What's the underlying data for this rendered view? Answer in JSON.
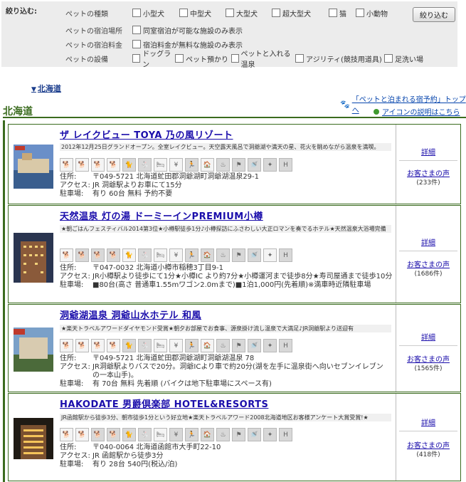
{
  "filter": {
    "title": "絞り込む:",
    "button": "絞り込む",
    "rows": [
      {
        "label": "ペットの種類",
        "options": [
          "小型犬",
          "中型犬",
          "大型犬",
          "超大型犬",
          "猫",
          "小動物"
        ]
      },
      {
        "label": "ペットの宿泊場所",
        "options": [
          "同室宿泊が可能な施設のみ表示"
        ]
      },
      {
        "label": "ペットの宿泊料金",
        "options": [
          "宿泊料金が無料な施設のみ表示"
        ]
      },
      {
        "label": "ペットの設備",
        "options": [
          "ドッグラン",
          "ペット預かり",
          "ペットと入れる温泉",
          "アジリティ(競技用道具)",
          "足洗い場"
        ]
      }
    ]
  },
  "region_link": "北海道",
  "top_link": "「ペットと泊まれる宿予約」トップへ",
  "region_title": "北海道",
  "icons_link": "アイコンの説明はこちら",
  "side": {
    "detail": "詳細",
    "voice": "お客さまの声"
  },
  "labels": {
    "address": "住所:",
    "access": "アクセス:",
    "parking": "駐車場:"
  },
  "hotels": [
    {
      "name": "ザ レイクビュー TOYA 乃の風リゾート",
      "catch": "2012年12月25日グランドオープン。全室レイクビュー。天空露天風呂で洞爺湖や満天の星、花火を眺めながら温泉を満喫。",
      "address": "〒049-5721 北海道虻田郡洞爺湖町洞爺湖温泉29-1",
      "access": "JR 洞爺駅よりお車にて15分",
      "parking": "有り 60台 無料 予約不要",
      "reviews": "(233件)"
    },
    {
      "name": "天然温泉 灯の湯 ドーミーインPREMIUM小樽",
      "catch": "★朝ごはんフェスティバル2014第3位★小樽駅徒歩1分♪小樽探訪にふさわしい大正ロマンを奏でるホテル★天然温泉大浴場完備",
      "address": "〒047-0032 北海道小樽市稲穂3丁目9-1",
      "access": "JR小樽駅より徒歩にて1分★小樽IC より約7分★小樽運河まで徒歩8分★寿司屋通まで徒歩10分",
      "parking": "■80台(高さ 普通車1.55mワゴン2.0mまで)■1泊1,000円(先着順)※満車時近隣駐車場",
      "reviews": "(1686件)"
    },
    {
      "name": "洞爺湖温泉 洞爺山水ホテル 和風",
      "catch": "★楽天トラベルアワードダイヤモンド受賞★朝夕お部屋でお食事、源泉掛け流し温泉で大満足♪JR洞爺駅より送迎有",
      "address": "〒049-5721 北海道虻田郡洞爺湖町洞爺湖温泉 78",
      "access": "JR洞爺駅よりバスで20分。洞爺ICより車で約20分(湖を左手に温泉街へ向いセブンイレブンの一本山手)。",
      "parking": "有 70台 無料 先着順 (バイクは地下駐車場にスペース有)",
      "reviews": "(1565件)"
    },
    {
      "name": "HAKODATE 男爵倶楽部 HOTEL&RESORTS",
      "catch": "JR函館駅から徒歩3分、朝市徒歩1分という好立地★楽天トラベルアワード2008北海道地区お客様アンケート大賞受賞!★",
      "address": "〒040-0064 北海道函館市大手町22-10",
      "access": "JR 函館駅から徒歩3分",
      "parking": "有り 28台 540円(税込/泊)",
      "reviews": "(418件)"
    }
  ]
}
